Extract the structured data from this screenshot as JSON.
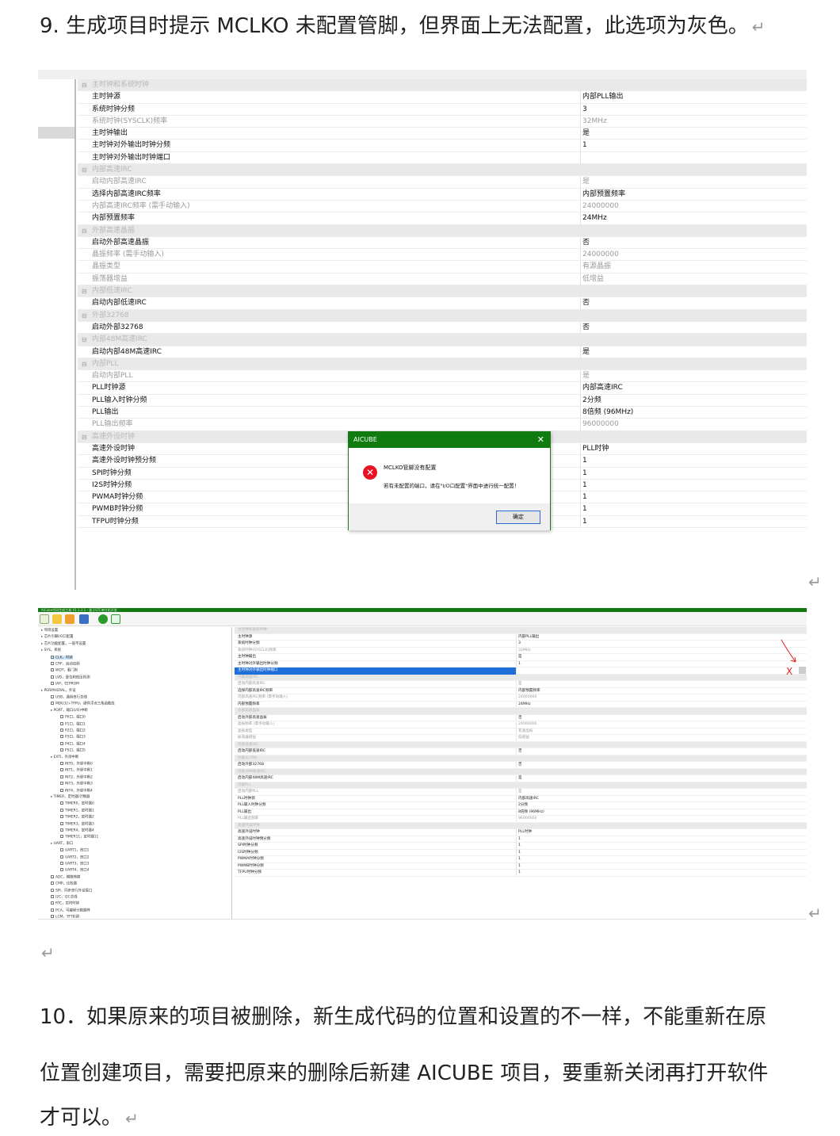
{
  "item9": {
    "text": "9.  生成项目时提示 MCLKO 未配置管脚，但界面上无法配置，此选项为灰色。",
    "mark": "↵"
  },
  "item10": {
    "lines": [
      "10．如果原来的项目被删除，新生成代码的位置和设置的不一样，不能重新在原",
      "位置创建项目，需要把原来的删除后新建 AICUBE 项目，要重新关闭再打开软件",
      "才可以。"
    ],
    "mark": "↵"
  },
  "empty_para_mark": "↵",
  "shot1": {
    "rows": [
      {
        "k": "主时钟和系统时钟",
        "v": "",
        "type": "cat"
      },
      {
        "k": "主时钟源",
        "v": "内部PLL输出",
        "type": ""
      },
      {
        "k": "系统时钟分频",
        "v": "3",
        "type": ""
      },
      {
        "k": "系统时钟(SYSCLK)频率",
        "v": "32MHz",
        "type": "dis"
      },
      {
        "k": "主时钟输出",
        "v": "是",
        "type": ""
      },
      {
        "k": "主时钟对外输出时钟分频",
        "v": "1",
        "type": ""
      },
      {
        "k": "主时钟对外输出时钟端口",
        "v": "",
        "type": ""
      },
      {
        "k": "内部高速IRC",
        "v": "",
        "type": "cat"
      },
      {
        "k": "启动内部高速IRC",
        "v": "是",
        "type": "dis"
      },
      {
        "k": "选择内部高速IRC频率",
        "v": "内部预置频率",
        "type": ""
      },
      {
        "k": "内部高速IRC频率 (需手动输入)",
        "v": "24000000",
        "type": "dis"
      },
      {
        "k": "内部预置频率",
        "v": "24MHz",
        "type": ""
      },
      {
        "k": "外部高速晶振",
        "v": "",
        "type": "cat"
      },
      {
        "k": "启动外部高速晶振",
        "v": "否",
        "type": ""
      },
      {
        "k": "晶振频率 (需手动输入)",
        "v": "24000000",
        "type": "dis"
      },
      {
        "k": "晶振类型",
        "v": "有源晶振",
        "type": "dis"
      },
      {
        "k": "振荡器增益",
        "v": "低增益",
        "type": "dis"
      },
      {
        "k": "内部低速IRC",
        "v": "",
        "type": "cat"
      },
      {
        "k": "启动内部低速IRC",
        "v": "否",
        "type": ""
      },
      {
        "k": "外部32768",
        "v": "",
        "type": "cat"
      },
      {
        "k": "启动外部32768",
        "v": "否",
        "type": ""
      },
      {
        "k": "内部48M高速IRC",
        "v": "",
        "type": "cat"
      },
      {
        "k": "启动内部48M高速IRC",
        "v": "是",
        "type": ""
      },
      {
        "k": "内部PLL",
        "v": "",
        "type": "cat"
      },
      {
        "k": "启动内部PLL",
        "v": "是",
        "type": "dis"
      },
      {
        "k": "PLL时钟源",
        "v": "内部高速IRC",
        "type": ""
      },
      {
        "k": "PLL输入时钟分频",
        "v": "2分频",
        "type": ""
      },
      {
        "k": "PLL输出",
        "v": "8倍频 (96MHz)",
        "type": ""
      },
      {
        "k": "PLL输出频率",
        "v": "96000000",
        "type": "dis"
      },
      {
        "k": "高速外设时钟",
        "v": "",
        "type": "cat"
      },
      {
        "k": "高速外设时钟",
        "v": "PLL时钟",
        "type": ""
      },
      {
        "k": "高速外设时钟预分频",
        "v": "1",
        "type": ""
      },
      {
        "k": "SPI时钟分频",
        "v": "1",
        "type": ""
      },
      {
        "k": "I2S时钟分频",
        "v": "1",
        "type": ""
      },
      {
        "k": "PWMA时钟分频",
        "v": "1",
        "type": ""
      },
      {
        "k": "PWMB时钟分频",
        "v": "1",
        "type": ""
      },
      {
        "k": "TFPU时钟分频",
        "v": "1",
        "type": ""
      }
    ],
    "dialog": {
      "title": "AICUBE",
      "close": "✕",
      "message": "MCLKO管脚没有配置",
      "detail": "若有未配置的端口，请在\"I/O口配置\"界面中进行统一配置！",
      "ok": "确定"
    }
  },
  "shot2": {
    "title": "AiCube代码生成工具 V1.1.2.1 - 基于STC单片机开发",
    "tree": [
      {
        "t": "项目设置",
        "d": 0,
        "cb": false
      },
      {
        "t": "芯片引脚I/O口配置",
        "d": 0,
        "cb": false
      },
      {
        "t": "芯片功能配置，一般不设置",
        "d": 0,
        "cb": false
      },
      {
        "t": "SYS，系统",
        "d": 0,
        "cb": false
      },
      {
        "t": "CLK，时钟",
        "d": 1,
        "cb": true,
        "sel": true
      },
      {
        "t": "CRF，自动追频",
        "d": 1,
        "cb": true
      },
      {
        "t": "WDT，看门狗",
        "d": 1,
        "cb": true
      },
      {
        "t": "LVD，复位和低压检测",
        "d": 1,
        "cb": true
      },
      {
        "t": "IAP，EEPROM",
        "d": 1,
        "cb": true
      },
      {
        "t": "PERIPHERAL，外设",
        "d": 0,
        "cb": false
      },
      {
        "t": "USB，通用串行总线",
        "d": 1,
        "cb": true
      },
      {
        "t": "MDU32+TFPU，硬件浮点三角函数库",
        "d": 1,
        "cb": true
      },
      {
        "t": "PORT，端口(I/O)中断",
        "d": 1,
        "cb": false
      },
      {
        "t": "P0口，端口0",
        "d": 2,
        "cb": true
      },
      {
        "t": "P1口，端口1",
        "d": 2,
        "cb": true
      },
      {
        "t": "P2口，端口2",
        "d": 2,
        "cb": true
      },
      {
        "t": "P3口，端口3",
        "d": 2,
        "cb": true
      },
      {
        "t": "P4口，端口4",
        "d": 2,
        "cb": true
      },
      {
        "t": "P5口，端口5",
        "d": 2,
        "cb": true
      },
      {
        "t": "EXTI，外部中断",
        "d": 1,
        "cb": false
      },
      {
        "t": "INT0，外部中断0",
        "d": 2,
        "cb": true
      },
      {
        "t": "INT1，外部中断1",
        "d": 2,
        "cb": true
      },
      {
        "t": "INT2，外部中断2",
        "d": 2,
        "cb": true
      },
      {
        "t": "INT3，外部中断3",
        "d": 2,
        "cb": true
      },
      {
        "t": "INT4，外部中断4",
        "d": 2,
        "cb": true
      },
      {
        "t": "TIMER，定时器/计数器",
        "d": 1,
        "cb": false
      },
      {
        "t": "TIMER0，定时器0",
        "d": 2,
        "cb": true
      },
      {
        "t": "TIMER1，定时器1",
        "d": 2,
        "cb": true
      },
      {
        "t": "TIMER2，定时器2",
        "d": 2,
        "cb": true
      },
      {
        "t": "TIMER3，定时器3",
        "d": 2,
        "cb": true
      },
      {
        "t": "TIMER4，定时器4",
        "d": 2,
        "cb": true
      },
      {
        "t": "TIMER11，定时器11",
        "d": 2,
        "cb": true
      },
      {
        "t": "UART，串口",
        "d": 1,
        "cb": false
      },
      {
        "t": "UART1，串口1",
        "d": 2,
        "cb": true
      },
      {
        "t": "UART2，串口2",
        "d": 2,
        "cb": true
      },
      {
        "t": "UART3，串口3",
        "d": 2,
        "cb": true
      },
      {
        "t": "UART4，串口4",
        "d": 2,
        "cb": true
      },
      {
        "t": "ADC，模数转换",
        "d": 1,
        "cb": true
      },
      {
        "t": "CMP，比较器",
        "d": 1,
        "cb": true
      },
      {
        "t": "SPI，同步串行外设接口",
        "d": 1,
        "cb": true
      },
      {
        "t": "I2C，I2C总线",
        "d": 1,
        "cb": true
      },
      {
        "t": "RTC，实时时钟",
        "d": 1,
        "cb": true
      },
      {
        "t": "PCA，可编程计数器阵",
        "d": 1,
        "cb": true
      },
      {
        "t": "LCM，TFT彩屏",
        "d": 1,
        "cb": true
      }
    ],
    "rows": [
      {
        "k": "主时钟和系统时钟",
        "v": "",
        "type": "cat"
      },
      {
        "k": "主时钟源",
        "v": "内部PLL输出",
        "type": ""
      },
      {
        "k": "系统时钟分频",
        "v": "3",
        "type": ""
      },
      {
        "k": "系统时钟(SYSCLK)频率",
        "v": "32MHz",
        "type": "dis"
      },
      {
        "k": "主时钟输出",
        "v": "是",
        "type": ""
      },
      {
        "k": "主时钟对外输出时钟分频",
        "v": "1",
        "type": ""
      },
      {
        "k": "主时钟对外输出时钟端口",
        "v": "",
        "type": "hl"
      },
      {
        "k": "内部高速IRC",
        "v": "",
        "type": "cat"
      },
      {
        "k": "启动内部高速IRC",
        "v": "是",
        "type": "dis"
      },
      {
        "k": "选择内部高速IRC频率",
        "v": "内部预置频率",
        "type": ""
      },
      {
        "k": "内部高速IRC频率 (需手动输入)",
        "v": "24000000",
        "type": "dis"
      },
      {
        "k": "内部预置频率",
        "v": "24MHz",
        "type": ""
      },
      {
        "k": "外部高速晶振",
        "v": "",
        "type": "cat"
      },
      {
        "k": "启动外部高速晶振",
        "v": "否",
        "type": ""
      },
      {
        "k": "晶振频率 (需手动输入)",
        "v": "24000000",
        "type": "dis"
      },
      {
        "k": "晶振类型",
        "v": "有源晶振",
        "type": "dis"
      },
      {
        "k": "振荡器增益",
        "v": "低增益",
        "type": "dis"
      },
      {
        "k": "内部低速IRC",
        "v": "",
        "type": "cat"
      },
      {
        "k": "启动内部低速IRC",
        "v": "否",
        "type": ""
      },
      {
        "k": "外部32768",
        "v": "",
        "type": "cat"
      },
      {
        "k": "启动外部32768",
        "v": "否",
        "type": ""
      },
      {
        "k": "内部48M高速IRC",
        "v": "",
        "type": "cat"
      },
      {
        "k": "启动内部48M高速IRC",
        "v": "是",
        "type": ""
      },
      {
        "k": "内部PLL",
        "v": "",
        "type": "cat"
      },
      {
        "k": "启动内部PLL",
        "v": "是",
        "type": "dis"
      },
      {
        "k": "PLL时钟源",
        "v": "内部高速IRC",
        "type": ""
      },
      {
        "k": "PLL输入时钟分频",
        "v": "2分频",
        "type": ""
      },
      {
        "k": "PLL输出",
        "v": "8倍频 (96MHz)",
        "type": ""
      },
      {
        "k": "PLL输出频率",
        "v": "96000000",
        "type": "dis"
      },
      {
        "k": "高速外设时钟",
        "v": "",
        "type": "cat"
      },
      {
        "k": "高速外设时钟",
        "v": "PLL时钟",
        "type": ""
      },
      {
        "k": "高速外设时钟预分频",
        "v": "1",
        "type": ""
      },
      {
        "k": "SPI时钟分频",
        "v": "1",
        "type": ""
      },
      {
        "k": "I2S时钟分频",
        "v": "1",
        "type": ""
      },
      {
        "k": "PWMA时钟分频",
        "v": "1",
        "type": ""
      },
      {
        "k": "PWMB时钟分频",
        "v": "1",
        "type": ""
      },
      {
        "k": "TFPU时钟分频",
        "v": "1",
        "type": ""
      }
    ],
    "annotation": "X",
    "colors": {
      "titlebar": "#137a13",
      "highlight": "#1e6fd9",
      "annotation": "#e02020"
    }
  }
}
